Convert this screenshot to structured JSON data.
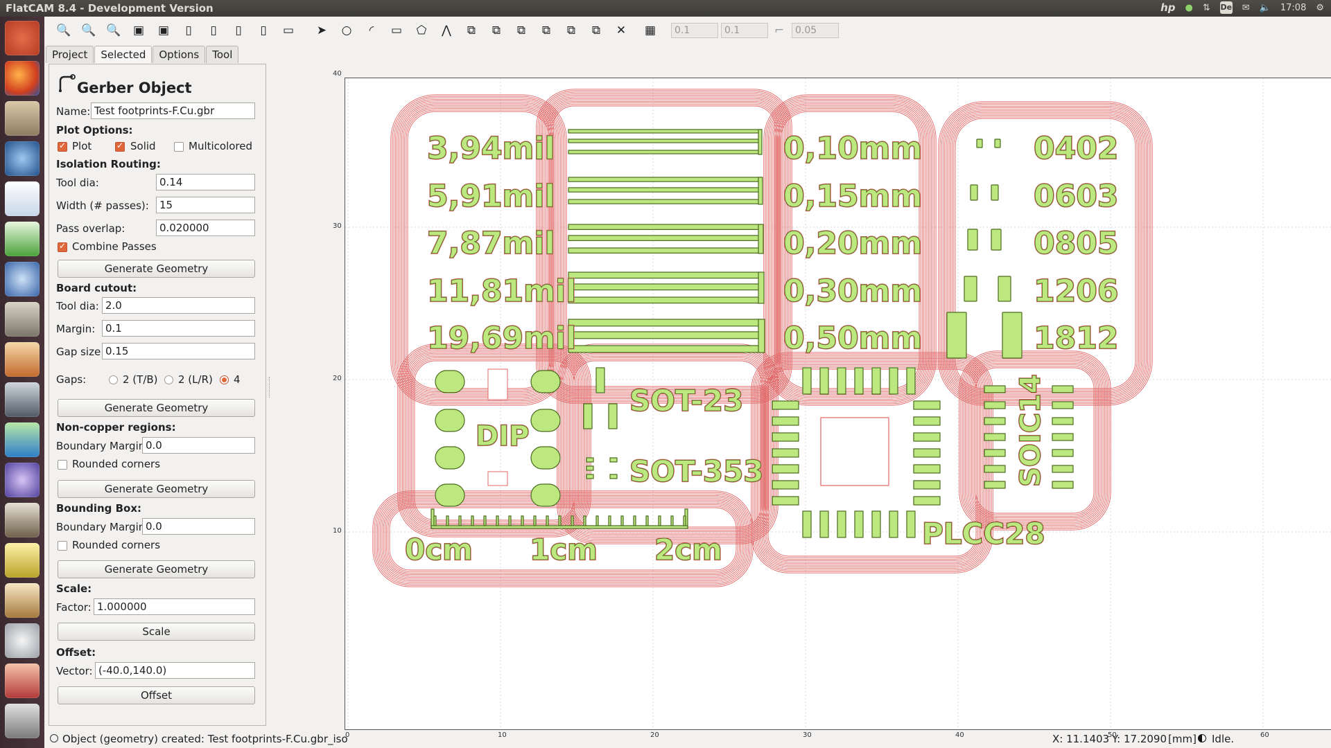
{
  "window": {
    "title": "FlatCAM 8.4 - Development Version"
  },
  "tray": {
    "clock": "17:08",
    "keyboard": "De"
  },
  "toolbar": {
    "inputs": [
      "0.1",
      "0.1",
      "0.05"
    ]
  },
  "tabs": [
    {
      "label": "Project"
    },
    {
      "label": "Selected"
    },
    {
      "label": "Options"
    },
    {
      "label": "Tool"
    }
  ],
  "panel": {
    "heading": "Gerber Object",
    "name_label": "Name:",
    "name_value": "Test footprints-F.Cu.gbr",
    "plot_options": "Plot Options:",
    "plot": "Plot",
    "solid": "Solid",
    "multicolored": "Multicolored",
    "isolation": "Isolation Routing:",
    "tool_dia_label": "Tool dia:",
    "tool_dia_value": "0.14",
    "width_label": "Width (# passes):",
    "width_value": "15",
    "overlap_label": "Pass overlap:",
    "overlap_value": "0.020000",
    "combine": "Combine Passes",
    "gen_geom": "Generate Geometry",
    "cutout": "Board cutout:",
    "cut_tool_label": "Tool dia:",
    "cut_tool_value": "2.0",
    "margin_label": "Margin:",
    "margin_value": "0.1",
    "gap_label": "Gap size:",
    "gap_value": "0.15",
    "gaps_label": "Gaps:",
    "gap_tb": "2 (T/B)",
    "gap_lr": "2 (L/R)",
    "gap_4": "4",
    "noncopper": "Non-copper regions:",
    "boundary_label": "Boundary Margin:",
    "boundary_value": "0.0",
    "rounded": "Rounded corners",
    "bbox": "Bounding Box:",
    "bbox_boundary_value": "0.0",
    "scale_hdr": "Scale:",
    "factor_label": "Factor:",
    "factor_value": "1.000000",
    "scale_btn": "Scale",
    "offset_hdr": "Offset:",
    "vector_label": "Vector:",
    "vector_value": "(-40.0,140.0)",
    "offset_btn": "Offset"
  },
  "plot": {
    "x_ticks": [
      "0",
      "10",
      "20",
      "30",
      "40",
      "50",
      "60"
    ],
    "y_ticks": [
      "10",
      "20",
      "30",
      "40"
    ],
    "colors": {
      "trace": "#e06464",
      "copper": "#bde87f",
      "outline": "#4a6a1f"
    },
    "mil_labels": [
      "3,94mil",
      "5,91mil",
      "7,87mil",
      "11,81mil",
      "19,69mil"
    ],
    "mm_labels": [
      "0,10mm",
      "0,15mm",
      "0,20mm",
      "0,30mm",
      "0,50mm"
    ],
    "chip_labels": [
      "0402",
      "0603",
      "0805",
      "1206",
      "1812"
    ],
    "dip": "DIP",
    "sot23": "SOT-23",
    "sot353": "SOT-353",
    "soic": "SOIC14",
    "plcc": "PLCC28",
    "ruler": [
      "0cm",
      "1cm",
      "2cm"
    ]
  },
  "status": {
    "message": "Object (geometry) created: Test footprints-F.Cu.gbr_iso",
    "x": "X: 11.1403",
    "y": "Y: 17.2090",
    "units": "[mm]",
    "state": "Idle."
  }
}
